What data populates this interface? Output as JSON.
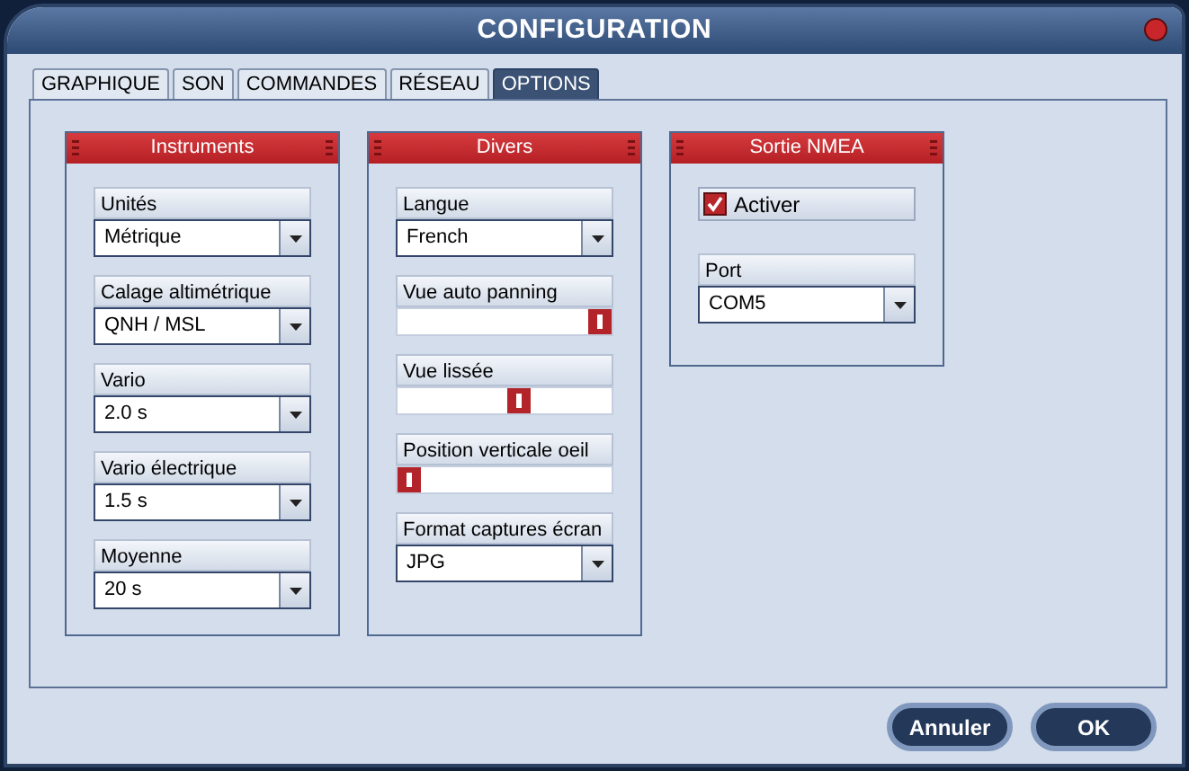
{
  "window": {
    "title": "CONFIGURATION"
  },
  "tabs": [
    {
      "label": "GRAPHIQUE",
      "selected": false
    },
    {
      "label": "SON",
      "selected": false
    },
    {
      "label": "COMMANDES",
      "selected": false
    },
    {
      "label": "RÉSEAU",
      "selected": false
    },
    {
      "label": "OPTIONS",
      "selected": true
    }
  ],
  "groups": [
    {
      "title": "Instruments",
      "items": [
        {
          "kind": "dropdown",
          "label": "Unités",
          "value": "Métrique"
        },
        {
          "kind": "dropdown",
          "label": "Calage altimétrique",
          "value": "QNH / MSL"
        },
        {
          "kind": "dropdown",
          "label": "Vario",
          "value": "2.0 s"
        },
        {
          "kind": "dropdown",
          "label": "Vario électrique",
          "value": "1.5 s"
        },
        {
          "kind": "dropdown",
          "label": "Moyenne",
          "value": "20 s"
        }
      ]
    },
    {
      "title": "Divers",
      "items": [
        {
          "kind": "dropdown",
          "label": "Langue",
          "value": "French"
        },
        {
          "kind": "slider",
          "label": "Vue auto panning",
          "level": 1
        },
        {
          "kind": "slider",
          "label": "Vue lissée",
          "level": 0.58
        },
        {
          "kind": "slider",
          "label": "Position verticale oeil",
          "level": 0
        },
        {
          "kind": "dropdown",
          "label": "Format captures écran",
          "value": "JPG"
        }
      ]
    },
    {
      "title": "Sortie NMEA",
      "items": [
        {
          "kind": "checkbox",
          "label": "Activer",
          "checked": true
        },
        {
          "kind": "dropdown",
          "label": "Port",
          "value": "COM5"
        }
      ]
    }
  ],
  "buttons": [
    "Annuler",
    "OK"
  ]
}
